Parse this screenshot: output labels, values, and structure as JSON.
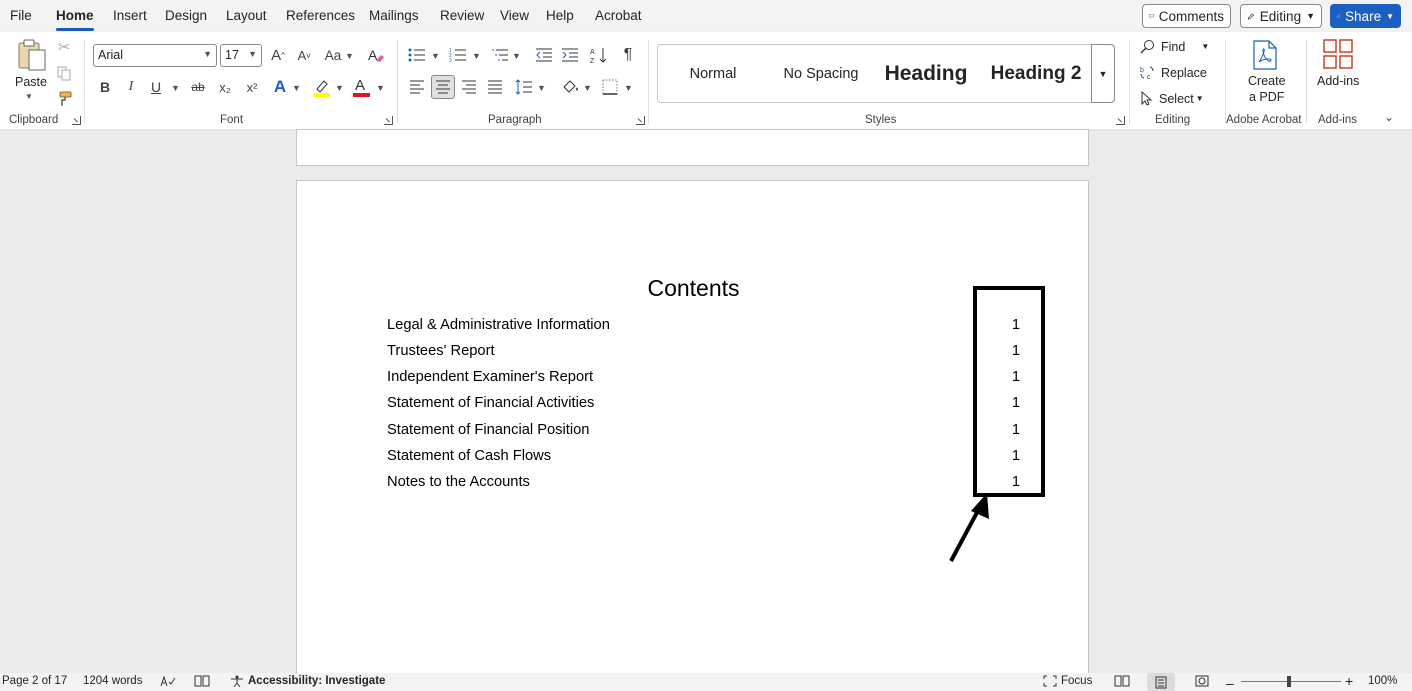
{
  "menu": {
    "tabs": [
      "File",
      "Home",
      "Insert",
      "Design",
      "Layout",
      "References",
      "Mailings",
      "Review",
      "View",
      "Help",
      "Acrobat"
    ],
    "active": "Home",
    "comments_label": "Comments",
    "editing_label": "Editing",
    "share_label": "Share"
  },
  "ribbon": {
    "clipboard": {
      "label": "Clipboard",
      "paste": "Paste"
    },
    "font": {
      "label": "Font",
      "family": "Arial",
      "size": "17",
      "bold": "B",
      "italic": "I",
      "underline": "U",
      "strike": "ab",
      "sub": "x₂",
      "sup": "x²",
      "grow": "A",
      "shrink": "A",
      "case": "Aa",
      "color_a": "A",
      "effects_a": "A"
    },
    "paragraph": {
      "label": "Paragraph",
      "pilcrow": "¶"
    },
    "styles": {
      "label": "Styles",
      "items": [
        "Normal",
        "No Spacing",
        "Heading",
        "Heading 2"
      ]
    },
    "editing": {
      "label": "Editing",
      "find": "Find",
      "replace": "Replace",
      "select": "Select"
    },
    "acrobat": {
      "label": "Adobe Acrobat",
      "create_line1": "Create",
      "create_line2": "a PDF"
    },
    "addins": {
      "label": "Add-ins",
      "button": "Add-ins"
    }
  },
  "document": {
    "title": "Contents",
    "toc": [
      {
        "title": "Legal & Administrative Information",
        "page": "1"
      },
      {
        "title": "Trustees' Report",
        "page": "1"
      },
      {
        "title": "Independent Examiner's Report",
        "page": "1"
      },
      {
        "title": "Statement of Financial Activities",
        "page": "1"
      },
      {
        "title": "Statement of Financial Position",
        "page": "1"
      },
      {
        "title": "Statement of Cash Flows",
        "page": "1"
      },
      {
        "title": "Notes to the Accounts",
        "page": "1"
      }
    ]
  },
  "status": {
    "page": "Page 2 of 17",
    "words": "1204 words",
    "accessibility": "Accessibility: Investigate",
    "focus": "Focus",
    "zoom": "100%"
  },
  "colors": {
    "accent": "#185abd",
    "share_bg": "#1b5fbf",
    "highlight_yellow": "#ffff00",
    "font_red": "#e81123"
  },
  "icons": [
    "cut-icon",
    "copy-icon",
    "format-painter-icon",
    "clear-format-icon",
    "bullets-icon",
    "numbering-icon",
    "multilevel-icon",
    "decrease-indent-icon",
    "increase-indent-icon",
    "sort-icon",
    "pilcrow-icon",
    "align-left-icon",
    "align-center-icon",
    "align-right-icon",
    "justify-icon",
    "line-spacing-icon",
    "shading-icon",
    "borders-icon",
    "search-icon",
    "replace-icon",
    "select-icon",
    "pdf-icon",
    "addins-icon",
    "collapse-ribbon-icon",
    "proofing-icon",
    "read-mode-icon",
    "accessibility-icon",
    "focus-icon",
    "print-layout-icon",
    "web-layout-icon",
    "arrow-annotation"
  ]
}
